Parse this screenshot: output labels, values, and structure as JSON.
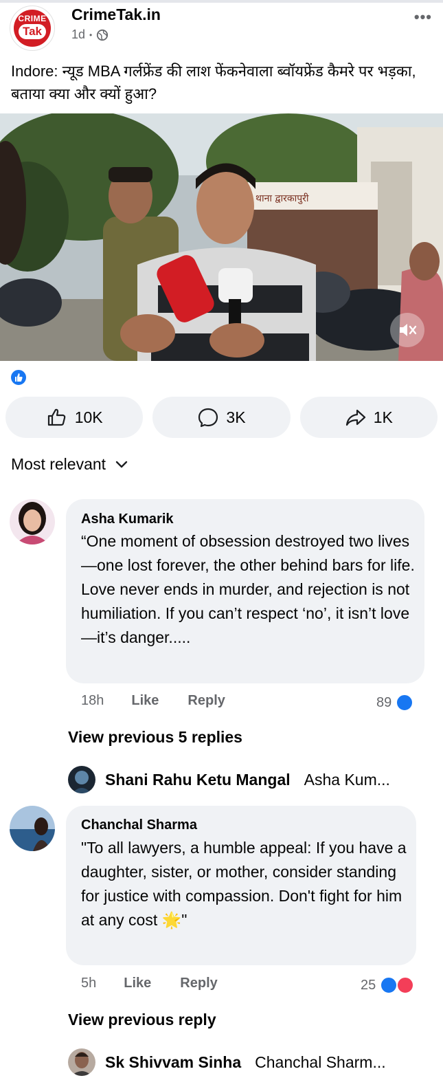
{
  "post": {
    "page_name": "CrimeTak.in",
    "logo_text_top": "CRIME",
    "logo_text_bottom": "Tak",
    "time": "1d",
    "dot": "•",
    "more": "•••",
    "caption": "Indore: न्यूड MBA गर्लफ्रेंड की लाश फेंकनेवाला ब्वॉयफ्रेंड कैमरे पर भड़का, बताया क्या और क्यों हुआ?",
    "video_sign": "थाना द्वारकापुरी"
  },
  "actions": {
    "like_count": "10K",
    "comment_count": "3K",
    "share_count": "1K"
  },
  "sort": {
    "label": "Most relevant"
  },
  "comments": [
    {
      "author": "Asha Kumarik",
      "text": "“One moment of obsession destroyed two lives—one lost forever, the other behind bars for life. Love never ends in murder, and rejection is not humiliation. If you can’t respect ‘no’, it isn’t love—it’s danger.....",
      "time": "18h",
      "like": "Like",
      "reply": "Reply",
      "reactions": "89",
      "view_previous": "View previous 5 replies",
      "reply_preview": {
        "author": "Shani Rahu Ketu Mangal",
        "text": "Asha Kum..."
      }
    },
    {
      "author": "Chanchal Sharma",
      "text": "\"To all lawyers, a humble appeal: If you have a daughter, sister, or mother, consider standing for justice with compassion. Don't fight for him at any cost 🌟\"",
      "time": "5h",
      "like": "Like",
      "reply": "Reply",
      "reactions": "25",
      "view_previous": "View previous reply",
      "reply_preview": {
        "author": "Sk Shivvam Sinha",
        "text": "Chanchal Sharm..."
      }
    }
  ],
  "colors": {
    "facebook_blue": "#1877f2",
    "love_red": "#f33e58",
    "brand_red": "#d21d24",
    "pill_bg": "#f0f2f5",
    "muted_text": "#65676b"
  }
}
